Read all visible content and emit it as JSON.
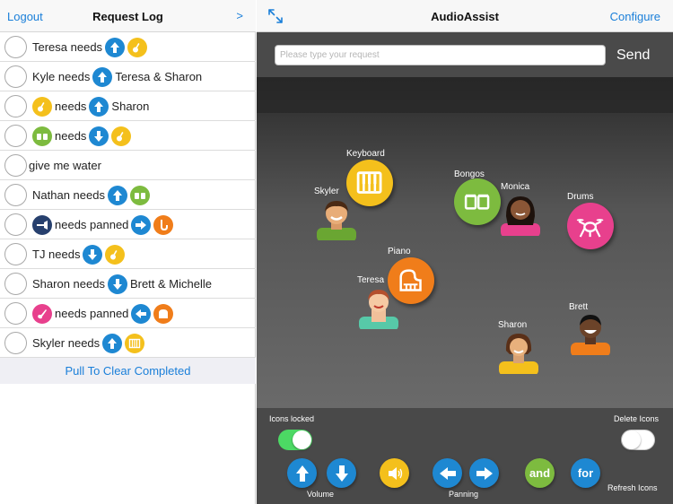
{
  "left_nav": {
    "logout": "Logout",
    "title": "Request Log",
    "next": ">"
  },
  "requests": [
    {
      "parts": [
        "Teresa needs"
      ],
      "icons": [
        "volume-up-icon",
        "guitar-icon"
      ]
    },
    {
      "parts": [
        "Kyle needs",
        "Teresa & Sharon"
      ],
      "icons": [
        "volume-up-icon"
      ]
    },
    {
      "parts": [
        "needs",
        "Sharon"
      ],
      "icons": [
        "guitar-icon",
        "volume-up-icon"
      ]
    },
    {
      "parts": [
        "needs"
      ],
      "icons": [
        "bongos-icon",
        "volume-down-icon",
        "guitar-icon"
      ]
    },
    {
      "parts": [
        "give me water"
      ],
      "icons": []
    },
    {
      "parts": [
        "Nathan needs"
      ],
      "icons": [
        "volume-up-icon",
        "bongos-icon"
      ]
    },
    {
      "parts": [
        "needs panned"
      ],
      "icons": [
        "trumpet-icon",
        "pan-right-icon",
        "saxophone-icon"
      ]
    },
    {
      "parts": [
        "TJ needs"
      ],
      "icons": [
        "volume-down-icon",
        "guitar-icon"
      ]
    },
    {
      "parts": [
        "Sharon needs",
        "Brett & Michelle"
      ],
      "icons": [
        "volume-down-icon"
      ]
    },
    {
      "parts": [
        "needs panned"
      ],
      "icons": [
        "electric-guitar-icon",
        "pan-left-icon",
        "piano-icon"
      ]
    },
    {
      "parts": [
        "Skyler needs"
      ],
      "icons": [
        "volume-up-icon",
        "keyboard-icon"
      ]
    }
  ],
  "pull_to_clear": "Pull To Clear Completed",
  "right_nav": {
    "title": "AudioAssist",
    "configure": "Configure",
    "expand_icon": "expand-icon"
  },
  "request_input": {
    "placeholder": "Please type your request",
    "value": ""
  },
  "send_label": "Send",
  "stage": {
    "people": {
      "skyler": "Skyler",
      "teresa": "Teresa",
      "monica": "Monica",
      "sharon": "Sharon",
      "brett": "Brett"
    },
    "instruments": {
      "keyboard": "Keyboard",
      "bongos": "Bongos",
      "drums": "Drums",
      "piano": "Piano"
    }
  },
  "controls": {
    "icons_locked": "Icons locked",
    "icons_locked_on": true,
    "delete_icons": "Delete Icons",
    "delete_icons_on": false,
    "volume": "Volume",
    "panning": "Panning",
    "and": "and",
    "for": "for",
    "refresh_icons": "Refresh Icons"
  },
  "colors": {
    "accent": "#1a7fd9",
    "blue": "#1e88d2",
    "yellow": "#f4c01c",
    "green": "#7dbb3f",
    "orange": "#f07d1a",
    "pink": "#e8408d",
    "toggle_on": "#4cd964"
  }
}
